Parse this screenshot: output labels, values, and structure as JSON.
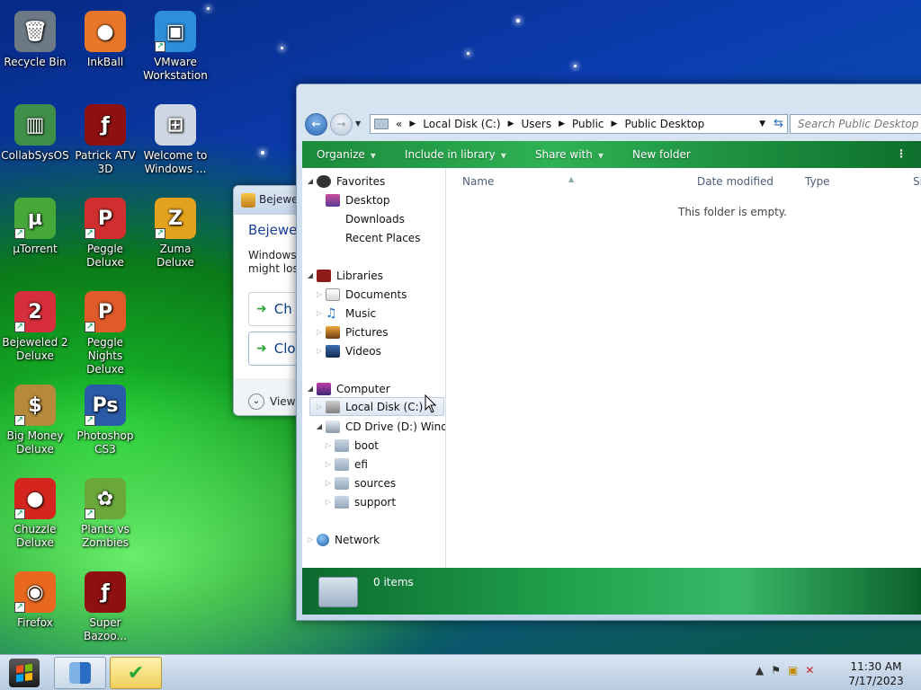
{
  "desktop": {
    "icons": [
      {
        "label": "Recycle Bin",
        "icon": "recycle-bin-icon",
        "color": "#6d7a86"
      },
      {
        "label": "InkBall",
        "icon": "inkball-icon",
        "color": "#e8772b"
      },
      {
        "label": "VMware Workstation",
        "icon": "vmware-icon",
        "color": "#2e8ed9"
      },
      {
        "label": "CollabSysOS",
        "icon": "collabsysos-icon",
        "color": "#3f8f4a"
      },
      {
        "label": "Patrick ATV 3D",
        "icon": "flash-icon",
        "color": "#8e1010"
      },
      {
        "label": "Welcome to Windows ...",
        "icon": "windows-orb-icon",
        "color": "#cfd8e2"
      },
      {
        "label": "µTorrent",
        "icon": "utorrent-icon",
        "color": "#47a83a"
      },
      {
        "label": "Peggle Deluxe",
        "icon": "peggle-icon",
        "color": "#d12f2f"
      },
      {
        "label": "Zuma Deluxe",
        "icon": "zuma-icon",
        "color": "#e3a21d"
      },
      {
        "label": "Bejeweled 2 Deluxe",
        "icon": "bejeweled-icon",
        "color": "#d62e3a"
      },
      {
        "label": "Peggle Nights Deluxe",
        "icon": "peggle-nights-icon",
        "color": "#e05a2a"
      },
      {
        "label": "Big Money Deluxe",
        "icon": "money-bag-icon",
        "color": "#b58a3a"
      },
      {
        "label": "Photoshop CS3",
        "icon": "photoshop-icon",
        "color": "#2a5ba8"
      },
      {
        "label": "Chuzzle Deluxe",
        "icon": "chuzzle-icon",
        "color": "#d4261f"
      },
      {
        "label": "Plants vs Zombies",
        "icon": "plants-vs-zombies-icon",
        "color": "#6aa83a"
      },
      {
        "label": "Firefox",
        "icon": "firefox-icon",
        "color": "#e8681f"
      },
      {
        "label": "Super Bazoo...",
        "icon": "flash-icon",
        "color": "#8e1010"
      }
    ]
  },
  "dialog": {
    "title": "Bejewel",
    "heading": "Bejewel",
    "text_line1": "Windows",
    "text_line2": "might lose",
    "option1": "Ch",
    "option2": "Clo",
    "footer": "View"
  },
  "explorer": {
    "back_icon": "back-arrow-icon",
    "forward_icon": "forward-arrow-icon",
    "breadcrumb_overflow": "«",
    "breadcrumb": [
      "Local Disk (C:)",
      "Users",
      "Public",
      "Public Desktop"
    ],
    "search_placeholder": "Search Public Desktop",
    "toolbar": {
      "organize": "Organize",
      "include_in_library": "Include in library",
      "share_with": "Share with",
      "new_folder": "New folder"
    },
    "nav": {
      "favorites": "Favorites",
      "desktop": "Desktop",
      "downloads": "Downloads",
      "recent_places": "Recent Places",
      "libraries": "Libraries",
      "documents": "Documents",
      "music": "Music",
      "pictures": "Pictures",
      "videos": "Videos",
      "computer": "Computer",
      "local_disk": "Local Disk (C:)",
      "cd_drive": "CD Drive (D:) Windo",
      "boot": "boot",
      "efi": "efi",
      "sources": "sources",
      "support": "support",
      "network": "Network"
    },
    "columns": {
      "name": "Name",
      "date_modified": "Date modified",
      "type": "Type",
      "size": "Si"
    },
    "empty_message": "This folder is empty.",
    "item_count": "0 items"
  },
  "taskbar": {
    "time": "11:30 AM",
    "date": "7/17/2023"
  },
  "colors": {
    "toolbar_green": "#2fb155",
    "desktop_blue": "#0b3db0",
    "desktop_green": "#19c42c"
  }
}
